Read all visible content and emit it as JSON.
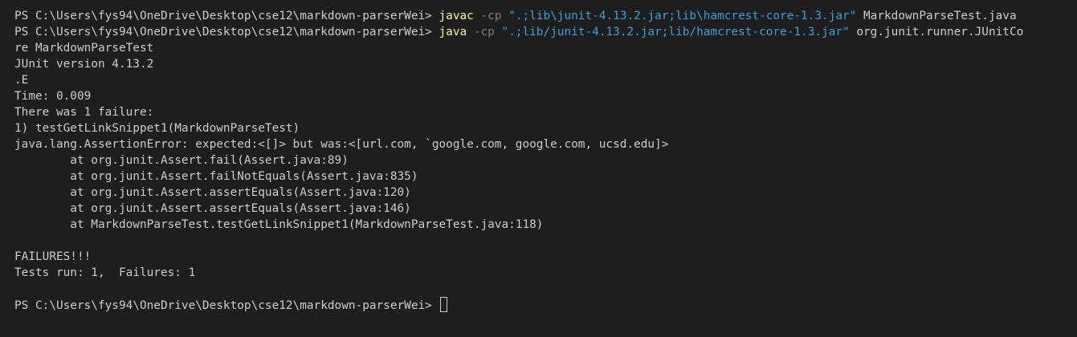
{
  "terminal": {
    "prompt": "PS C:\\Users\\fys94\\OneDrive\\Desktop\\cse12\\markdown-parserWei> ",
    "cmd1": {
      "program": "javac",
      "flag": " -cp ",
      "classpath": "\".;lib\\junit-4.13.2.jar;lib\\hamcrest-core-1.3.jar\"",
      "args": " MarkdownParseTest.java"
    },
    "cmd2": {
      "program": "java",
      "flag": " -cp ",
      "classpath": "\".;lib/junit-4.13.2.jar;lib/hamcrest-core-1.3.jar\"",
      "args": " org.junit.runner.JUnitCo",
      "args_wrap": "re MarkdownParseTest"
    },
    "output": [
      "JUnit version 4.13.2",
      ".E",
      "Time: 0.009",
      "There was 1 failure:",
      "1) testGetLinkSnippet1(MarkdownParseTest)",
      "java.lang.AssertionError: expected:<[]> but was:<[url.com, `google.com, google.com, ucsd.edu]>",
      "        at org.junit.Assert.fail(Assert.java:89)",
      "        at org.junit.Assert.failNotEquals(Assert.java:835)",
      "        at org.junit.Assert.assertEquals(Assert.java:120)",
      "        at org.junit.Assert.assertEquals(Assert.java:146)",
      "        at MarkdownParseTest.testGetLinkSnippet1(MarkdownParseTest.java:118)"
    ],
    "summary": [
      "FAILURES!!!",
      "Tests run: 1,  Failures: 1"
    ],
    "colors": {
      "background": "#1e1e1e",
      "text": "#cccccc",
      "command": "#f9f1a5",
      "flag": "#808080",
      "string": "#3b9fd6"
    }
  }
}
